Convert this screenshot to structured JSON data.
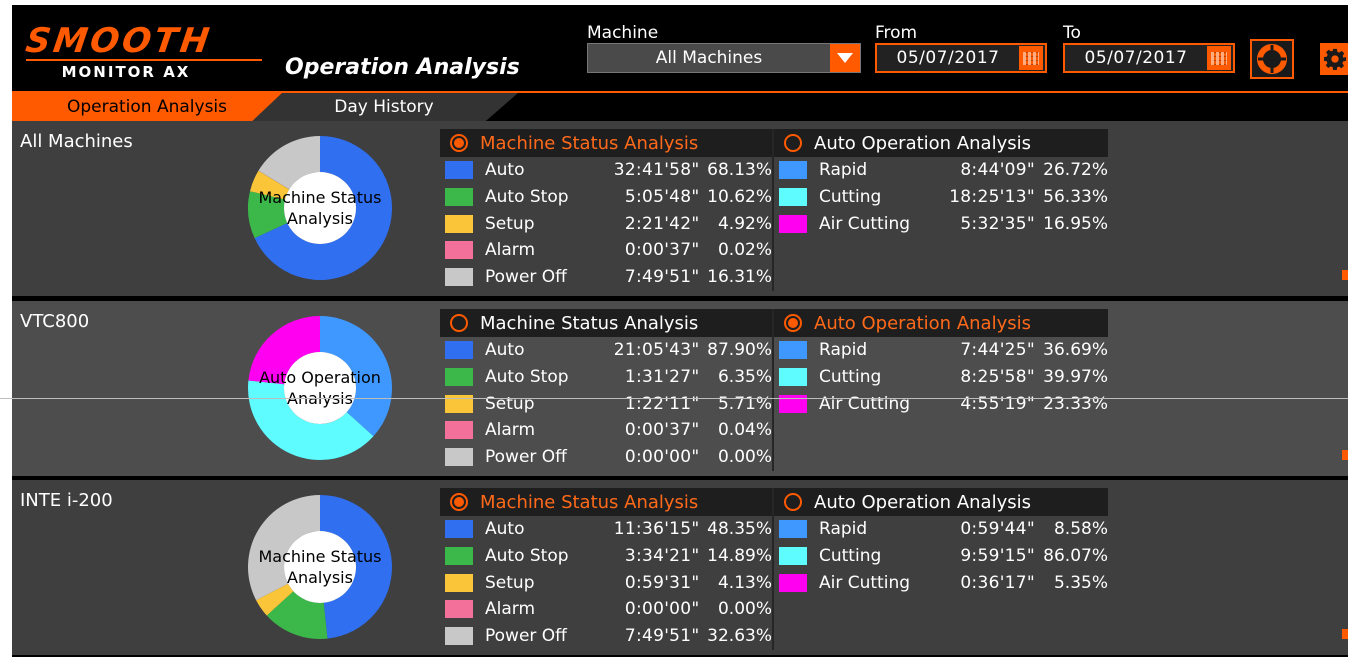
{
  "header": {
    "logo_brand": "SMOOTH",
    "logo_sub": "MONITOR AX",
    "title": "Operation Analysis",
    "machine_label": "Machine",
    "machine_value": "All Machines",
    "from_label": "From",
    "from_value": "05/07/2017",
    "to_label": "To",
    "to_value": "05/07/2017"
  },
  "tabs": [
    {
      "label": "Operation Analysis",
      "active": true
    },
    {
      "label": "Day History",
      "active": false
    }
  ],
  "colors": {
    "accent": "#ff5a00",
    "auto": "#2f6ff0",
    "auto_stop": "#3cb84a",
    "setup": "#fbc53a",
    "alarm": "#f2709a",
    "power_off": "#c8c8c8",
    "rapid": "#3f98ff",
    "cutting": "#5ffcff",
    "air_cutting": "#ff00f0"
  },
  "panels": [
    {
      "name": "All Machines",
      "selected": "status",
      "donut_label": [
        "Machine Status",
        "Analysis"
      ],
      "status_title": "Machine Status Analysis",
      "auto_title": "Auto Operation Analysis",
      "status": [
        {
          "label": "Auto",
          "time": "32:41'58\"",
          "pct": "68.13%",
          "value": 68.13
        },
        {
          "label": "Auto Stop",
          "time": "5:05'48\"",
          "pct": "10.62%",
          "value": 10.62
        },
        {
          "label": "Setup",
          "time": "2:21'42\"",
          "pct": "4.92%",
          "value": 4.92
        },
        {
          "label": "Alarm",
          "time": "0:00'37\"",
          "pct": "0.02%",
          "value": 0.02
        },
        {
          "label": "Power Off",
          "time": "7:49'51\"",
          "pct": "16.31%",
          "value": 16.31
        }
      ],
      "auto": [
        {
          "label": "Rapid",
          "time": "8:44'09\"",
          "pct": "26.72%",
          "value": 26.72
        },
        {
          "label": "Cutting",
          "time": "18:25'13\"",
          "pct": "56.33%",
          "value": 56.33
        },
        {
          "label": "Air Cutting",
          "time": "5:32'35\"",
          "pct": "16.95%",
          "value": 16.95
        }
      ]
    },
    {
      "name": "VTC800",
      "selected": "auto",
      "donut_label": [
        "Auto Operation",
        "Analysis"
      ],
      "status_title": "Machine Status Analysis",
      "auto_title": "Auto Operation Analysis",
      "status": [
        {
          "label": "Auto",
          "time": "21:05'43\"",
          "pct": "87.90%",
          "value": 87.9
        },
        {
          "label": "Auto Stop",
          "time": "1:31'27\"",
          "pct": "6.35%",
          "value": 6.35
        },
        {
          "label": "Setup",
          "time": "1:22'11\"",
          "pct": "5.71%",
          "value": 5.71
        },
        {
          "label": "Alarm",
          "time": "0:00'37\"",
          "pct": "0.04%",
          "value": 0.04
        },
        {
          "label": "Power Off",
          "time": "0:00'00\"",
          "pct": "0.00%",
          "value": 0.0
        }
      ],
      "auto": [
        {
          "label": "Rapid",
          "time": "7:44'25\"",
          "pct": "36.69%",
          "value": 36.69
        },
        {
          "label": "Cutting",
          "time": "8:25'58\"",
          "pct": "39.97%",
          "value": 39.97
        },
        {
          "label": "Air Cutting",
          "time": "4:55'19\"",
          "pct": "23.33%",
          "value": 23.33
        }
      ]
    },
    {
      "name": "INTE i-200",
      "selected": "status",
      "donut_label": [
        "Machine Status",
        "Analysis"
      ],
      "status_title": "Machine Status Analysis",
      "auto_title": "Auto Operation Analysis",
      "status": [
        {
          "label": "Auto",
          "time": "11:36'15\"",
          "pct": "48.35%",
          "value": 48.35
        },
        {
          "label": "Auto Stop",
          "time": "3:34'21\"",
          "pct": "14.89%",
          "value": 14.89
        },
        {
          "label": "Setup",
          "time": "0:59'31\"",
          "pct": "4.13%",
          "value": 4.13
        },
        {
          "label": "Alarm",
          "time": "0:00'00\"",
          "pct": "0.00%",
          "value": 0.0
        },
        {
          "label": "Power Off",
          "time": "7:49'51\"",
          "pct": "32.63%",
          "value": 32.63
        }
      ],
      "auto": [
        {
          "label": "Rapid",
          "time": "0:59'44\"",
          "pct": "8.58%",
          "value": 8.58
        },
        {
          "label": "Cutting",
          "time": "9:59'15\"",
          "pct": "86.07%",
          "value": 86.07
        },
        {
          "label": "Air Cutting",
          "time": "0:36'17\"",
          "pct": "5.35%",
          "value": 5.35
        }
      ]
    }
  ]
}
